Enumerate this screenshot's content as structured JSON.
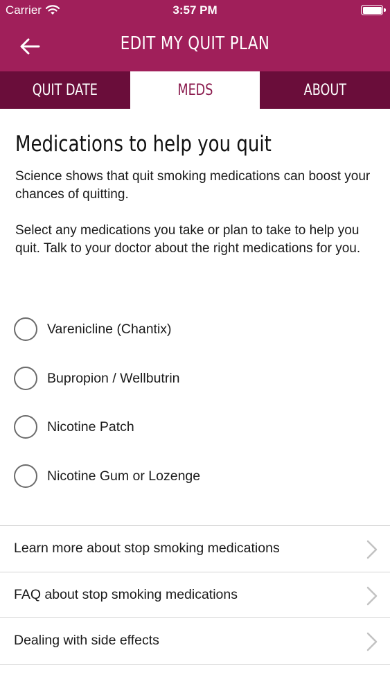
{
  "status_bar": {
    "carrier": "Carrier",
    "wifi_icon": "wifi-icon",
    "time": "3:57 PM",
    "battery_icon": "battery-icon"
  },
  "nav": {
    "back_icon": "arrow-left-icon",
    "title": "EDIT MY QUIT PLAN"
  },
  "tabs": [
    {
      "label": "QUIT DATE",
      "active": false
    },
    {
      "label": "MEDS",
      "active": true
    },
    {
      "label": "ABOUT",
      "active": false
    }
  ],
  "main": {
    "heading": "Medications to help you quit",
    "paragraph_1": "Science shows that quit smoking medications can boost your chances of quitting.",
    "paragraph_2": "Select any medications you take or plan to take to help you quit. Talk to your doctor about the right medications for you."
  },
  "medications": [
    {
      "label": "Varenicline (Chantix)",
      "selected": false
    },
    {
      "label": "Bupropion / Wellbutrin",
      "selected": false
    },
    {
      "label": "Nicotine Patch",
      "selected": false
    },
    {
      "label": "Nicotine Gum or Lozenge",
      "selected": false
    }
  ],
  "links": [
    {
      "label": "Learn more about stop smoking medications",
      "icon": "chevron-right-icon"
    },
    {
      "label": "FAQ about stop smoking medications",
      "icon": "chevron-right-icon"
    },
    {
      "label": "Dealing with side effects",
      "icon": "chevron-right-icon"
    }
  ],
  "colors": {
    "brand": "#a01f5a",
    "tab_bar": "#6a0d3a",
    "active_tab_text": "#8a1a4d",
    "radio_border": "#6b6b6b",
    "divider": "#d4d4d4"
  }
}
